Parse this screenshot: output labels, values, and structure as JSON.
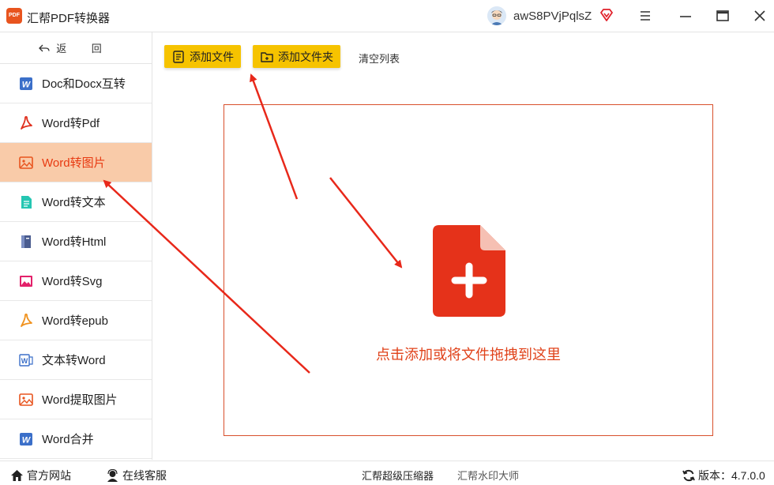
{
  "app": {
    "title": "汇帮PDF转换器",
    "logo_text": "PDF",
    "username": "awS8PVjPqlsZ",
    "accent_color": "#e8541e"
  },
  "sidebar": {
    "back_label": "返 回",
    "items": [
      {
        "label": "Doc和Docx互转",
        "icon": "word-icon"
      },
      {
        "label": "Word转Pdf",
        "icon": "pdf-icon"
      },
      {
        "label": "Word转图片",
        "icon": "image-icon",
        "active": true
      },
      {
        "label": "Word转文本",
        "icon": "text-file-icon"
      },
      {
        "label": "Word转Html",
        "icon": "html-book-icon"
      },
      {
        "label": "Word转Svg",
        "icon": "svg-image-icon"
      },
      {
        "label": "Word转epub",
        "icon": "epub-icon"
      },
      {
        "label": "文本转Word",
        "icon": "word-outline-icon"
      },
      {
        "label": "Word提取图片",
        "icon": "extract-image-icon"
      },
      {
        "label": "Word合并",
        "icon": "word-icon"
      }
    ],
    "active_color": "#f9cba9"
  },
  "toolbar": {
    "add_file_label": "添加文件",
    "add_folder_label": "添加文件夹",
    "clear_list_label": "清空列表",
    "button_color": "#f6c300"
  },
  "dropzone": {
    "hint": "点击添加或将文件拖拽到这里",
    "icon": "add-file-icon",
    "border_color": "#d8502c"
  },
  "footer": {
    "site_label": "官方网站",
    "service_label": "在线客服",
    "compress_label": "汇帮超级压缩器",
    "watermark_label": "汇帮水印大师",
    "version_label": "版本：4.7.0.0"
  }
}
